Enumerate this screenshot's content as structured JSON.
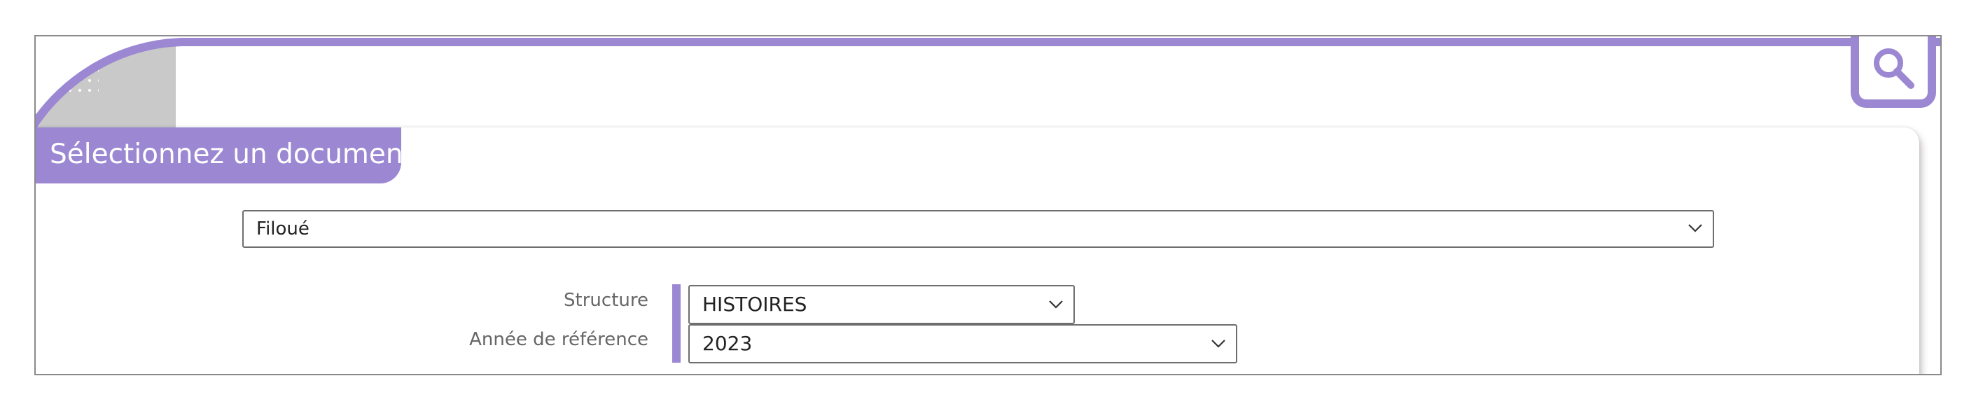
{
  "header": {
    "search_icon": "search-icon",
    "accent_color": "#9b87d2"
  },
  "card": {
    "title": "Sélectionnez un document"
  },
  "document_select": {
    "value": "Filoué",
    "icon": "chevron-down-icon"
  },
  "form": {
    "structure_label": "Structure",
    "structure_value": "HISTOIRES",
    "annee_label": "Année de référence",
    "annee_value": "2023"
  }
}
